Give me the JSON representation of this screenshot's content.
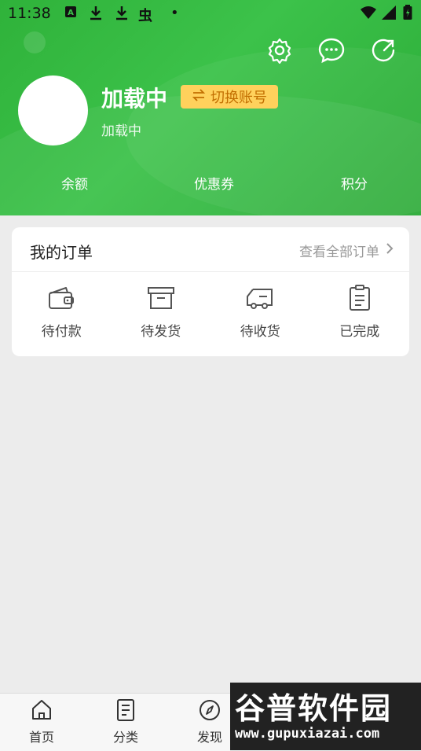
{
  "status_bar": {
    "time": "11:38",
    "icons": [
      "a-badge-icon",
      "download-icon",
      "download-icon",
      "bug-icon",
      "dot-icon",
      "wifi-icon",
      "signal-icon",
      "battery-icon"
    ]
  },
  "header": {
    "icons": [
      "settings-icon",
      "message-icon",
      "refresh-icon"
    ],
    "username": "加载中",
    "switch_account": "切换账号",
    "subtitle": "加载中",
    "stats": [
      "余额",
      "优惠券",
      "积分"
    ],
    "colors": {
      "primary": "#34b940",
      "switch_bg": "#ffd15c",
      "switch_text": "#c26e00"
    }
  },
  "orders": {
    "title": "我的订单",
    "view_all": "查看全部订单",
    "items": [
      {
        "label": "待付款",
        "icon": "wallet-icon"
      },
      {
        "label": "待发货",
        "icon": "box-icon"
      },
      {
        "label": "待收货",
        "icon": "truck-icon"
      },
      {
        "label": "已完成",
        "icon": "clipboard-icon"
      }
    ]
  },
  "bottom_nav": {
    "items": [
      {
        "label": "首页",
        "icon": "home-icon"
      },
      {
        "label": "分类",
        "icon": "list-icon"
      },
      {
        "label": "发现",
        "icon": "compass-icon"
      }
    ]
  },
  "watermark": {
    "title": "谷普软件园",
    "url": "www.gupuxiazai.com"
  }
}
